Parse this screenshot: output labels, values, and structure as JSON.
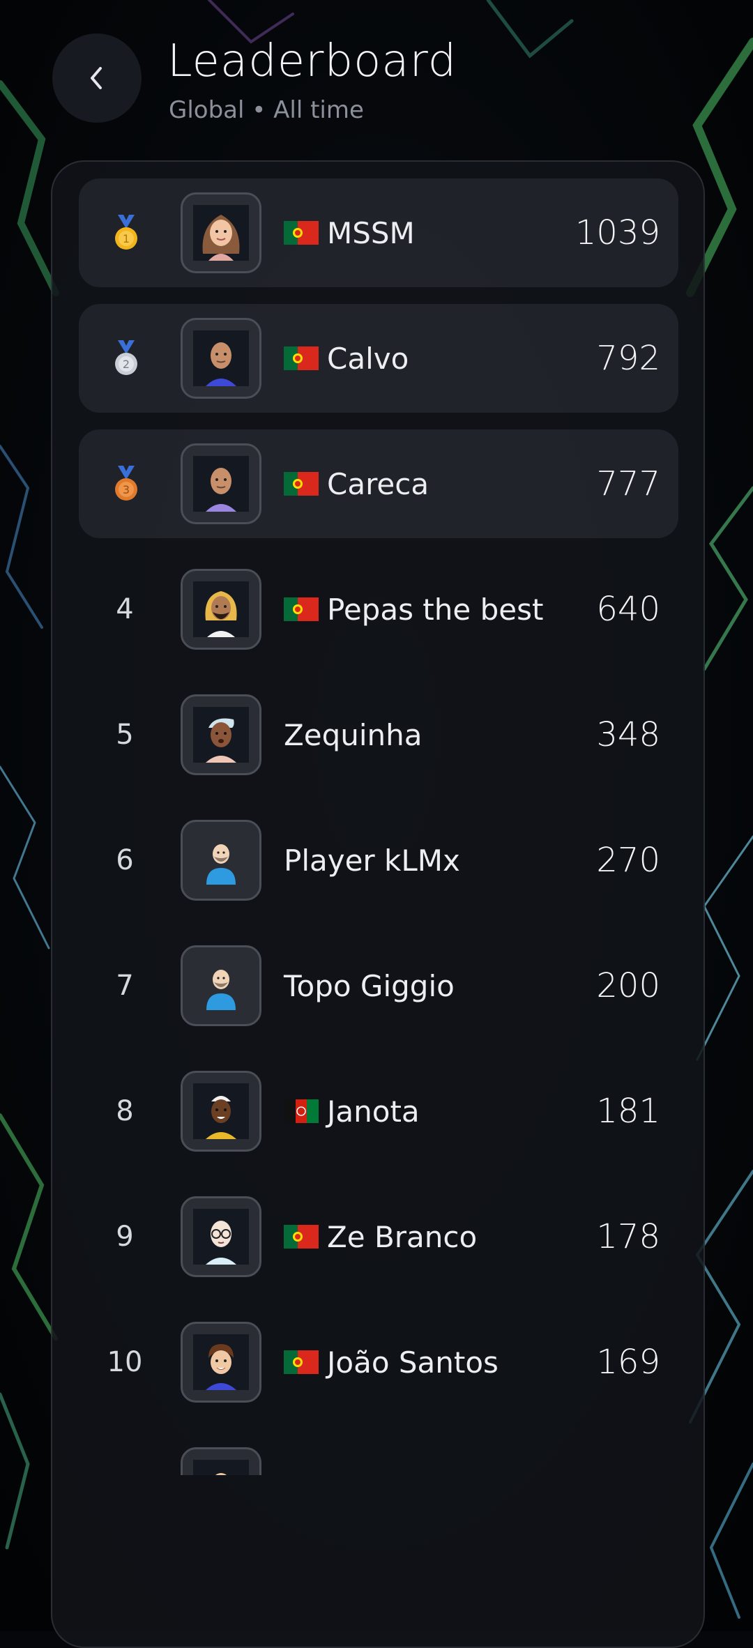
{
  "header": {
    "title": "Leaderboard",
    "subtitle": "Global • All time",
    "back_icon": "chevron-left-icon"
  },
  "colors": {
    "background": "#05070a",
    "panel": "#121419",
    "podium_row": "#262930",
    "gold": "#f3b51c",
    "silver": "#c9ced6",
    "bronze": "#e07a2c",
    "flag_pt_green": "#046a38",
    "flag_pt_red": "#da291c"
  },
  "leaderboard": [
    {
      "rank": "1",
      "medal": "gold",
      "flag": "portugal",
      "name": "MSSM",
      "score": "1039",
      "avatar": "woman-brown-hair-avatar"
    },
    {
      "rank": "2",
      "medal": "silver",
      "flag": "portugal",
      "name": "Calvo",
      "score": "792",
      "avatar": "bald-man-blue-shirt-avatar"
    },
    {
      "rank": "3",
      "medal": "bronze",
      "flag": "portugal",
      "name": "Careca",
      "score": "777",
      "avatar": "bald-man-purple-shirt-avatar"
    },
    {
      "rank": "4",
      "medal": null,
      "flag": "portugal",
      "name": "Pepas the best",
      "score": "640",
      "avatar": "blonde-bearded-avatar"
    },
    {
      "rank": "5",
      "medal": null,
      "flag": null,
      "name": "Zequinha",
      "score": "348",
      "avatar": "white-haired-man-avatar"
    },
    {
      "rank": "6",
      "medal": null,
      "flag": null,
      "name": "Player kLMx",
      "score": "270",
      "avatar": "default-player-avatar"
    },
    {
      "rank": "7",
      "medal": null,
      "flag": null,
      "name": "Topo Giggio",
      "score": "200",
      "avatar": "default-player-avatar"
    },
    {
      "rank": "8",
      "medal": null,
      "flag": "afghanistan",
      "name": "Janota",
      "score": "181",
      "avatar": "man-white-cap-avatar"
    },
    {
      "rank": "9",
      "medal": null,
      "flag": "portugal",
      "name": "Ze Branco",
      "score": "178",
      "avatar": "bald-man-glasses-avatar"
    },
    {
      "rank": "10",
      "medal": null,
      "flag": "portugal",
      "name": "João Santos",
      "score": "169",
      "avatar": "brown-hair-man-avatar"
    }
  ]
}
